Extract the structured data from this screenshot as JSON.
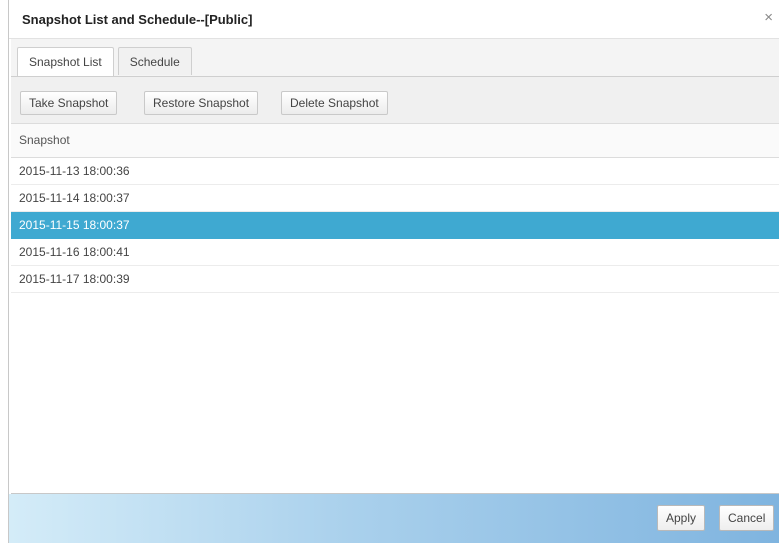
{
  "dialog": {
    "title": "Snapshot List and Schedule--[Public]",
    "close_glyph": "×"
  },
  "tabs": [
    {
      "label": "Snapshot List",
      "active": true
    },
    {
      "label": "Schedule",
      "active": false
    }
  ],
  "toolbar": {
    "take_label": "Take Snapshot",
    "restore_label": "Restore Snapshot",
    "delete_label": "Delete Snapshot"
  },
  "table": {
    "column_header": "Snapshot",
    "rows": [
      {
        "value": "2015-11-13 18:00:36",
        "selected": false
      },
      {
        "value": "2015-11-14 18:00:37",
        "selected": false
      },
      {
        "value": "2015-11-15 18:00:37",
        "selected": true
      },
      {
        "value": "2015-11-16 18:00:41",
        "selected": false
      },
      {
        "value": "2015-11-17 18:00:39",
        "selected": false
      }
    ]
  },
  "footer": {
    "apply_label": "Apply",
    "cancel_label": "Cancel"
  },
  "colors": {
    "selection": "#3fa9d1",
    "footer_gradient_start": "#d4ecf8",
    "footer_gradient_end": "#7fb4df"
  }
}
